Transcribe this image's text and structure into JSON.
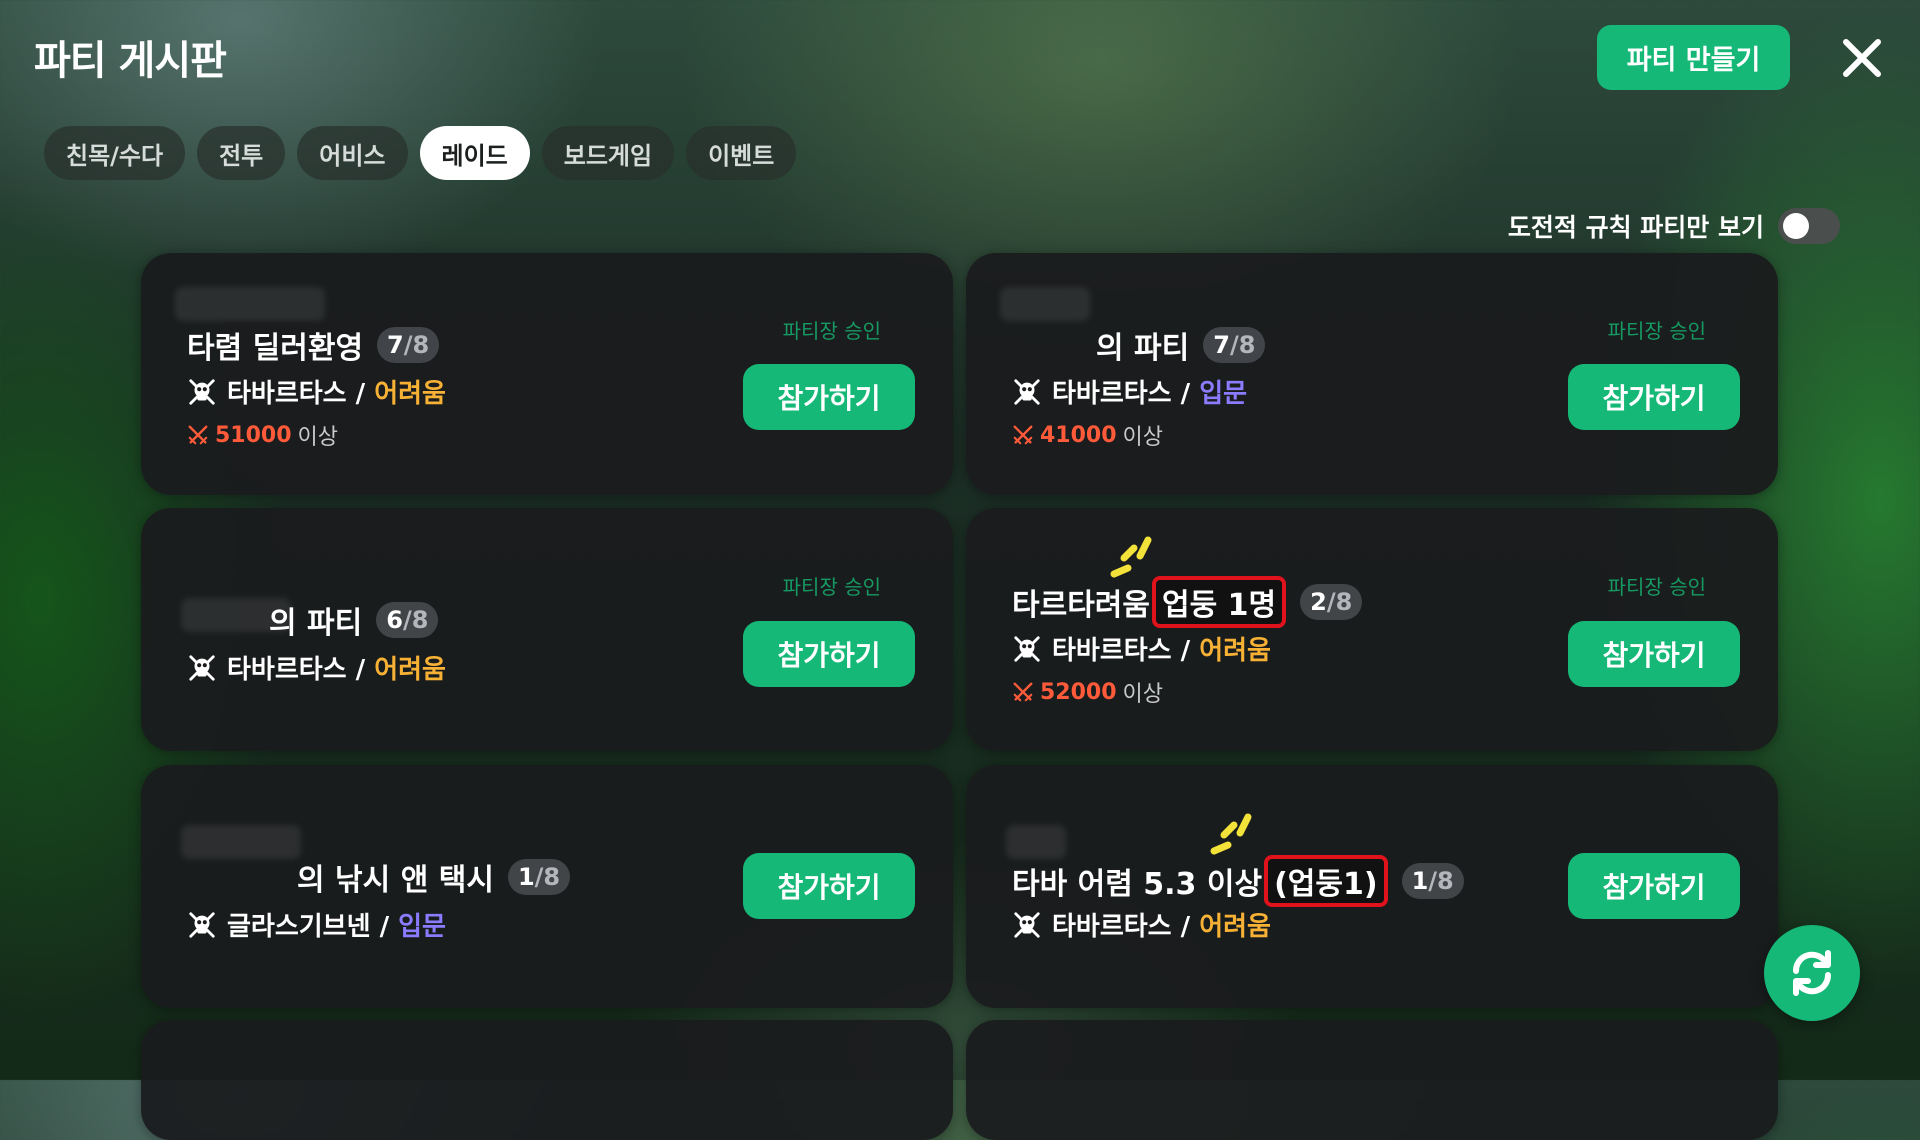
{
  "header": {
    "title": "파티 게시판",
    "create_label": "파티 만들기"
  },
  "tabs": [
    {
      "label": "친목/수다",
      "active": false
    },
    {
      "label": "전투",
      "active": false
    },
    {
      "label": "어비스",
      "active": false
    },
    {
      "label": "레이드",
      "active": true
    },
    {
      "label": "보드게임",
      "active": false
    },
    {
      "label": "이벤트",
      "active": false
    }
  ],
  "filter": {
    "label": "도전적 규칙 파티만 보기",
    "on": false
  },
  "cards": [
    {
      "title": "타렴 딜러환영",
      "cur": "7",
      "max": "/8",
      "approval": "파티장 승인",
      "dungeon": "타바르타스",
      "sep": " / ",
      "difficulty": "어려움",
      "power_value": "51000",
      "power_suffix": "이상",
      "join_label": "참가하기"
    },
    {
      "title": "의 파티",
      "cur": "7",
      "max": "/8",
      "approval": "파티장 승인",
      "dungeon": "타바르타스",
      "sep": " / ",
      "difficulty": "입문",
      "power_value": "41000",
      "power_suffix": "이상",
      "join_label": "참가하기"
    },
    {
      "title": "의 파티",
      "cur": "6",
      "max": "/8",
      "approval": "파티장 승인",
      "dungeon": "타바르타스",
      "sep": " / ",
      "difficulty": "어려움",
      "join_label": "참가하기"
    },
    {
      "title": "타르타려움",
      "highlight": "업둥 1명",
      "cur": "2",
      "max": "/8",
      "approval": "파티장 승인",
      "dungeon": "타바르타스",
      "sep": " / ",
      "difficulty": "어려움",
      "power_value": "52000",
      "power_suffix": "이상",
      "join_label": "참가하기"
    },
    {
      "title": "의 낚시 앤 택시",
      "cur": "1",
      "max": "/8",
      "dungeon": "글라스기브넨",
      "sep": " / ",
      "difficulty": "입문",
      "join_label": "참가하기"
    },
    {
      "title": "타바 어렴 5.3 이상",
      "highlight": "(업둥1)",
      "cur": "1",
      "max": "/8",
      "dungeon": "타바르타스",
      "sep": " / ",
      "difficulty": "어려움",
      "join_label": "참가하기"
    }
  ],
  "colors": {
    "accent": "#16b877",
    "hard": "#f7b236",
    "beginner": "#8b7bff",
    "power": "#ff5b3a",
    "highlight_border": "#e0121b"
  },
  "icons": {
    "close": "close-icon",
    "skull": "skull-crossbones-icon",
    "swords": "crossed-swords-icon",
    "refresh": "refresh-icon",
    "sparkle": "sparkle-lines-icon"
  }
}
